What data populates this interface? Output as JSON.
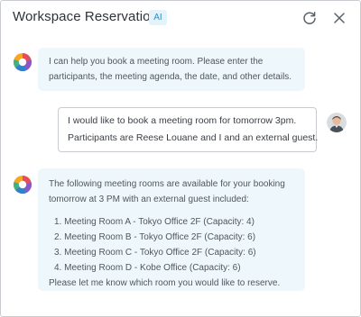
{
  "header": {
    "title": "Workspace Reservation",
    "badge": "AI",
    "refresh_icon": "refresh-icon",
    "close_icon": "close-icon"
  },
  "messages": [
    {
      "role": "assistant",
      "lines": [
        "I can help you book a meeting room. Please enter the",
        "participants, the meeting agenda, the date, and other details."
      ]
    },
    {
      "role": "user",
      "lines": [
        "I would like to book a meeting room for tomorrow 3pm.",
        "Participants are Reese Louane and I and an external guest."
      ]
    },
    {
      "role": "assistant",
      "intro": [
        "The following meeting rooms are available for your booking",
        "tomorrow at 3 PM with an external guest included:"
      ],
      "rooms": [
        "1. Meeting Room A - Tokyo Office 2F (Capacity: 4)",
        "2. Meeting Room B - Tokyo Office 2F (Capacity: 6)",
        "3. Meeting Room C - Tokyo Office 2F (Capacity: 6)",
        "4. Meeting Room D - Kobe Office (Capacity: 6)"
      ],
      "outro": "Please let me know which room you would like to reserve."
    }
  ],
  "colors": {
    "accent": "#2d8fc8",
    "bot_bubble": "#eef8fc",
    "user_bubble_border": "#c8ccd1",
    "logo_colors": [
      "#e84b5f",
      "#f6a623",
      "#3fb37f",
      "#2f80d1",
      "#8a56c9"
    ]
  }
}
